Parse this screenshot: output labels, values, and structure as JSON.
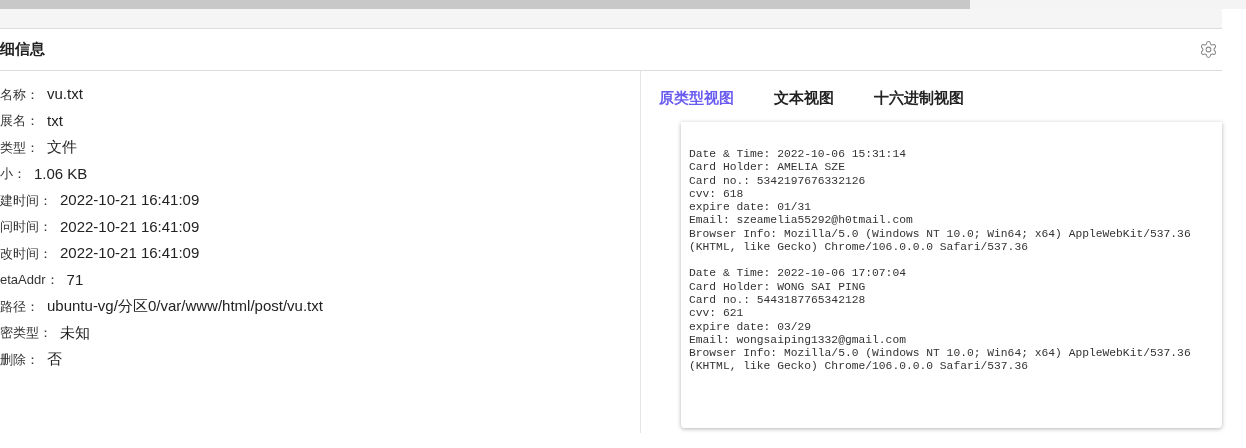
{
  "section": {
    "title": "细信息"
  },
  "properties": [
    {
      "label": "名称：",
      "value": "vu.txt"
    },
    {
      "label": "展名：",
      "value": "txt"
    },
    {
      "label": "类型：",
      "value": "文件"
    },
    {
      "label": "小：",
      "value": "1.06 KB"
    },
    {
      "label": "建时间：",
      "value": "2022-10-21 16:41:09"
    },
    {
      "label": "问时间：",
      "value": "2022-10-21 16:41:09"
    },
    {
      "label": "改时间：",
      "value": "2022-10-21 16:41:09"
    },
    {
      "label": "etaAddr：",
      "value": "71"
    },
    {
      "label": "路径：",
      "value": "ubuntu-vg/分区0/var/www/html/post/vu.txt"
    },
    {
      "label": "密类型：",
      "value": "未知"
    },
    {
      "label": "删除：",
      "value": "否"
    }
  ],
  "tabs": [
    {
      "label": "原类型视图",
      "selected": true
    },
    {
      "label": "文本视图",
      "selected": false
    },
    {
      "label": "十六进制视图",
      "selected": false
    }
  ],
  "content_blocks": [
    {
      "lines": [
        "Date & Time: 2022-10-06 15:31:14",
        "Card Holder: AMELIA SZE",
        "Card no.: 5342197676332126",
        "cvv: 618",
        "expire date: 01/31",
        "Email: szeamelia55292@h0tmail.com",
        "Browser Info: Mozilla/5.0 (Windows NT 10.0; Win64; x64) AppleWebKit/537.36",
        "(KHTML, like Gecko) Chrome/106.0.0.0 Safari/537.36"
      ]
    },
    {
      "lines": [
        "Date & Time: 2022-10-06 17:07:04",
        "Card Holder: WONG SAI PING",
        "Card no.: 5443187765342128",
        "cvv: 621",
        "expire date: 03/29",
        "Email: wongsaiping1332@gmail.com",
        "Browser Info: Mozilla/5.0 (Windows NT 10.0; Win64; x64) AppleWebKit/537.36",
        "(KHTML, like Gecko) Chrome/106.0.0.0 Safari/537.36"
      ]
    }
  ]
}
